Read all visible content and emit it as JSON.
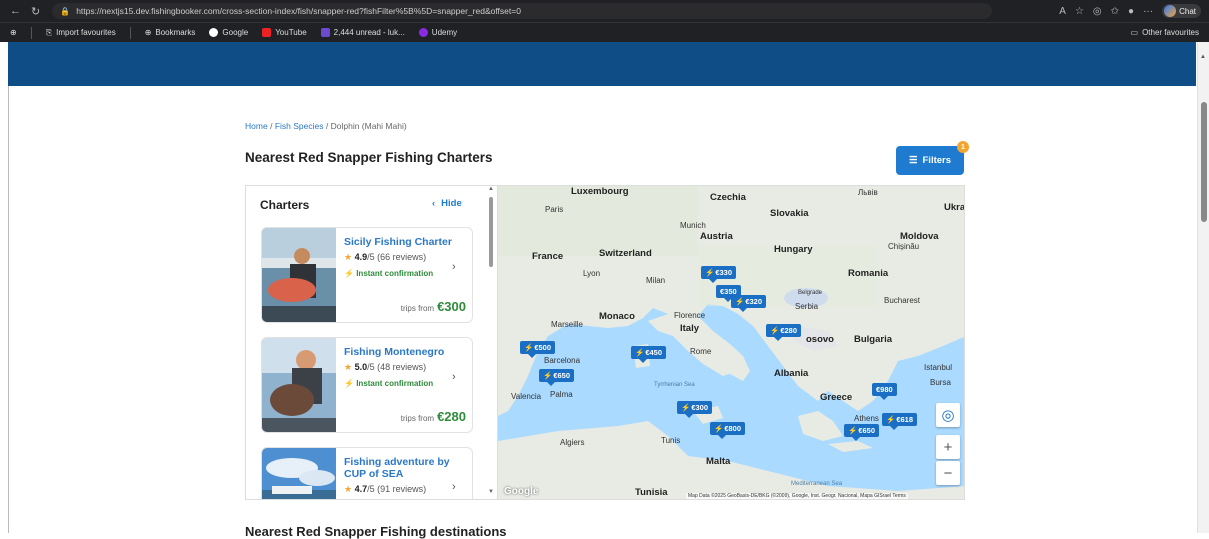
{
  "browser": {
    "url": "https://nextjs15.dev.fishingbooker.com/cross-section-index/fish/snapper-red?fishFilter%5B%5D=snapper_red&offset=0",
    "chat_label": "Chat"
  },
  "bookmarks": {
    "items": [
      {
        "label": "Import favourites"
      },
      {
        "label": "Bookmarks"
      },
      {
        "label": "Google"
      },
      {
        "label": "YouTube"
      },
      {
        "label": "2,444 unread - luk..."
      },
      {
        "label": "Udemy"
      }
    ],
    "other_label": "Other favourites"
  },
  "breadcrumb": {
    "home": "Home",
    "species": "Fish Species",
    "current": "Dolphin (Mahi Mahi)",
    "separator": "/"
  },
  "page_title": "Nearest Red Snapper Fishing Charters",
  "filters": {
    "label": "Filters",
    "badge": "1"
  },
  "charters_panel": {
    "title": "Charters",
    "hide_label": "Hide",
    "cards": [
      {
        "name": "Sicily Fishing Charter",
        "rating": "4.9",
        "rating_suffix": "/5",
        "reviews": "(66 reviews)",
        "instant": "Instant confirmation",
        "price_prefix": "trips from",
        "price": "€300"
      },
      {
        "name": "Fishing Montenegro",
        "rating": "5.0",
        "rating_suffix": "/5",
        "reviews": "(48 reviews)",
        "instant": "Instant confirmation",
        "price_prefix": "trips from",
        "price": "€280"
      },
      {
        "name": "Fishing adventure by CUP of SEA",
        "rating": "4.7",
        "rating_suffix": "/5",
        "reviews": "(91 reviews)"
      }
    ]
  },
  "map": {
    "labels": {
      "luxembourg": "Luxembourg",
      "czechia": "Czechia",
      "lviv": "Львів",
      "ukraine": "Ukra",
      "paris": "Paris",
      "munich": "Munich",
      "slovakia": "Slovakia",
      "austria": "Austria",
      "moldova": "Moldova",
      "chisinau": "Chișinău",
      "hungary": "Hungary",
      "france": "France",
      "switzerland": "Switzerland",
      "lyon": "Lyon",
      "milan": "Milan",
      "romania": "Romania",
      "belgrade": "Belgrade",
      "serbia": "Serbia",
      "bucharest": "Bucharest",
      "monaco": "Monaco",
      "florence": "Florence",
      "marseille": "Marseille",
      "italy": "Italy",
      "kosovo": "osovo",
      "bulgaria": "Bulgaria",
      "rome": "Rome",
      "barcelona": "Barcelona",
      "istanbul": "Istanbul",
      "albania": "Albania",
      "bursa": "Bursa",
      "tyrrhenian": "Tyrrhenian Sea",
      "valencia": "Valencia",
      "palma": "Palma",
      "greece": "Greece",
      "athens": "Athens",
      "algiers": "Algiers",
      "tunis": "Tunis",
      "malta": "Malta",
      "tunisia": "Tunisia",
      "med_sea": "Mediterranean Sea",
      "google": "Google"
    },
    "pins": [
      {
        "price": "€330",
        "instant": true
      },
      {
        "price": "€350",
        "instant": false
      },
      {
        "price": "€320",
        "instant": true
      },
      {
        "price": "€280",
        "instant": true
      },
      {
        "price": "€500",
        "instant": true
      },
      {
        "price": "€450",
        "instant": true
      },
      {
        "price": "€650",
        "instant": true
      },
      {
        "price": "€300",
        "instant": true
      },
      {
        "price": "€800",
        "instant": true
      },
      {
        "price": "€980",
        "instant": false
      },
      {
        "price": "€618",
        "instant": true
      },
      {
        "price": "€650",
        "instant": true
      }
    ],
    "attribution": "Map Data ©2025 GeoBasis-DE/BKG (©2009), Google, Inst. Geogr. Nacional, Mapa GISrael   Terms",
    "zoom_in": "+",
    "zoom_out": "−"
  },
  "next_section_title": "Nearest Red Snapper Fishing destinations",
  "colors": {
    "brand_blue": "#0e4d85",
    "accent": "#1e7bd0",
    "price_green": "#2e8b3a",
    "badge": "#f2a531"
  }
}
